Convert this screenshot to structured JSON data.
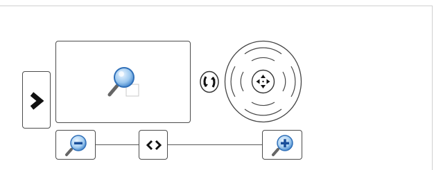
{
  "toolbar": {
    "expand_icon": "chevron-right-icon",
    "preview_icon": "magnifier-icon",
    "rotate_icon": "rotate-icon",
    "pan_icon": "pan-arrows-icon",
    "zoom_out_icon": "zoom-out-icon",
    "zoom_in_icon": "zoom-in-icon",
    "zoom_reset_icon": "fit-width-icon"
  },
  "colors": {
    "border": "#4a4a4a",
    "frame": "#cfcfcf",
    "lens_blue": "#2f7fd6",
    "handle": "#555555"
  }
}
